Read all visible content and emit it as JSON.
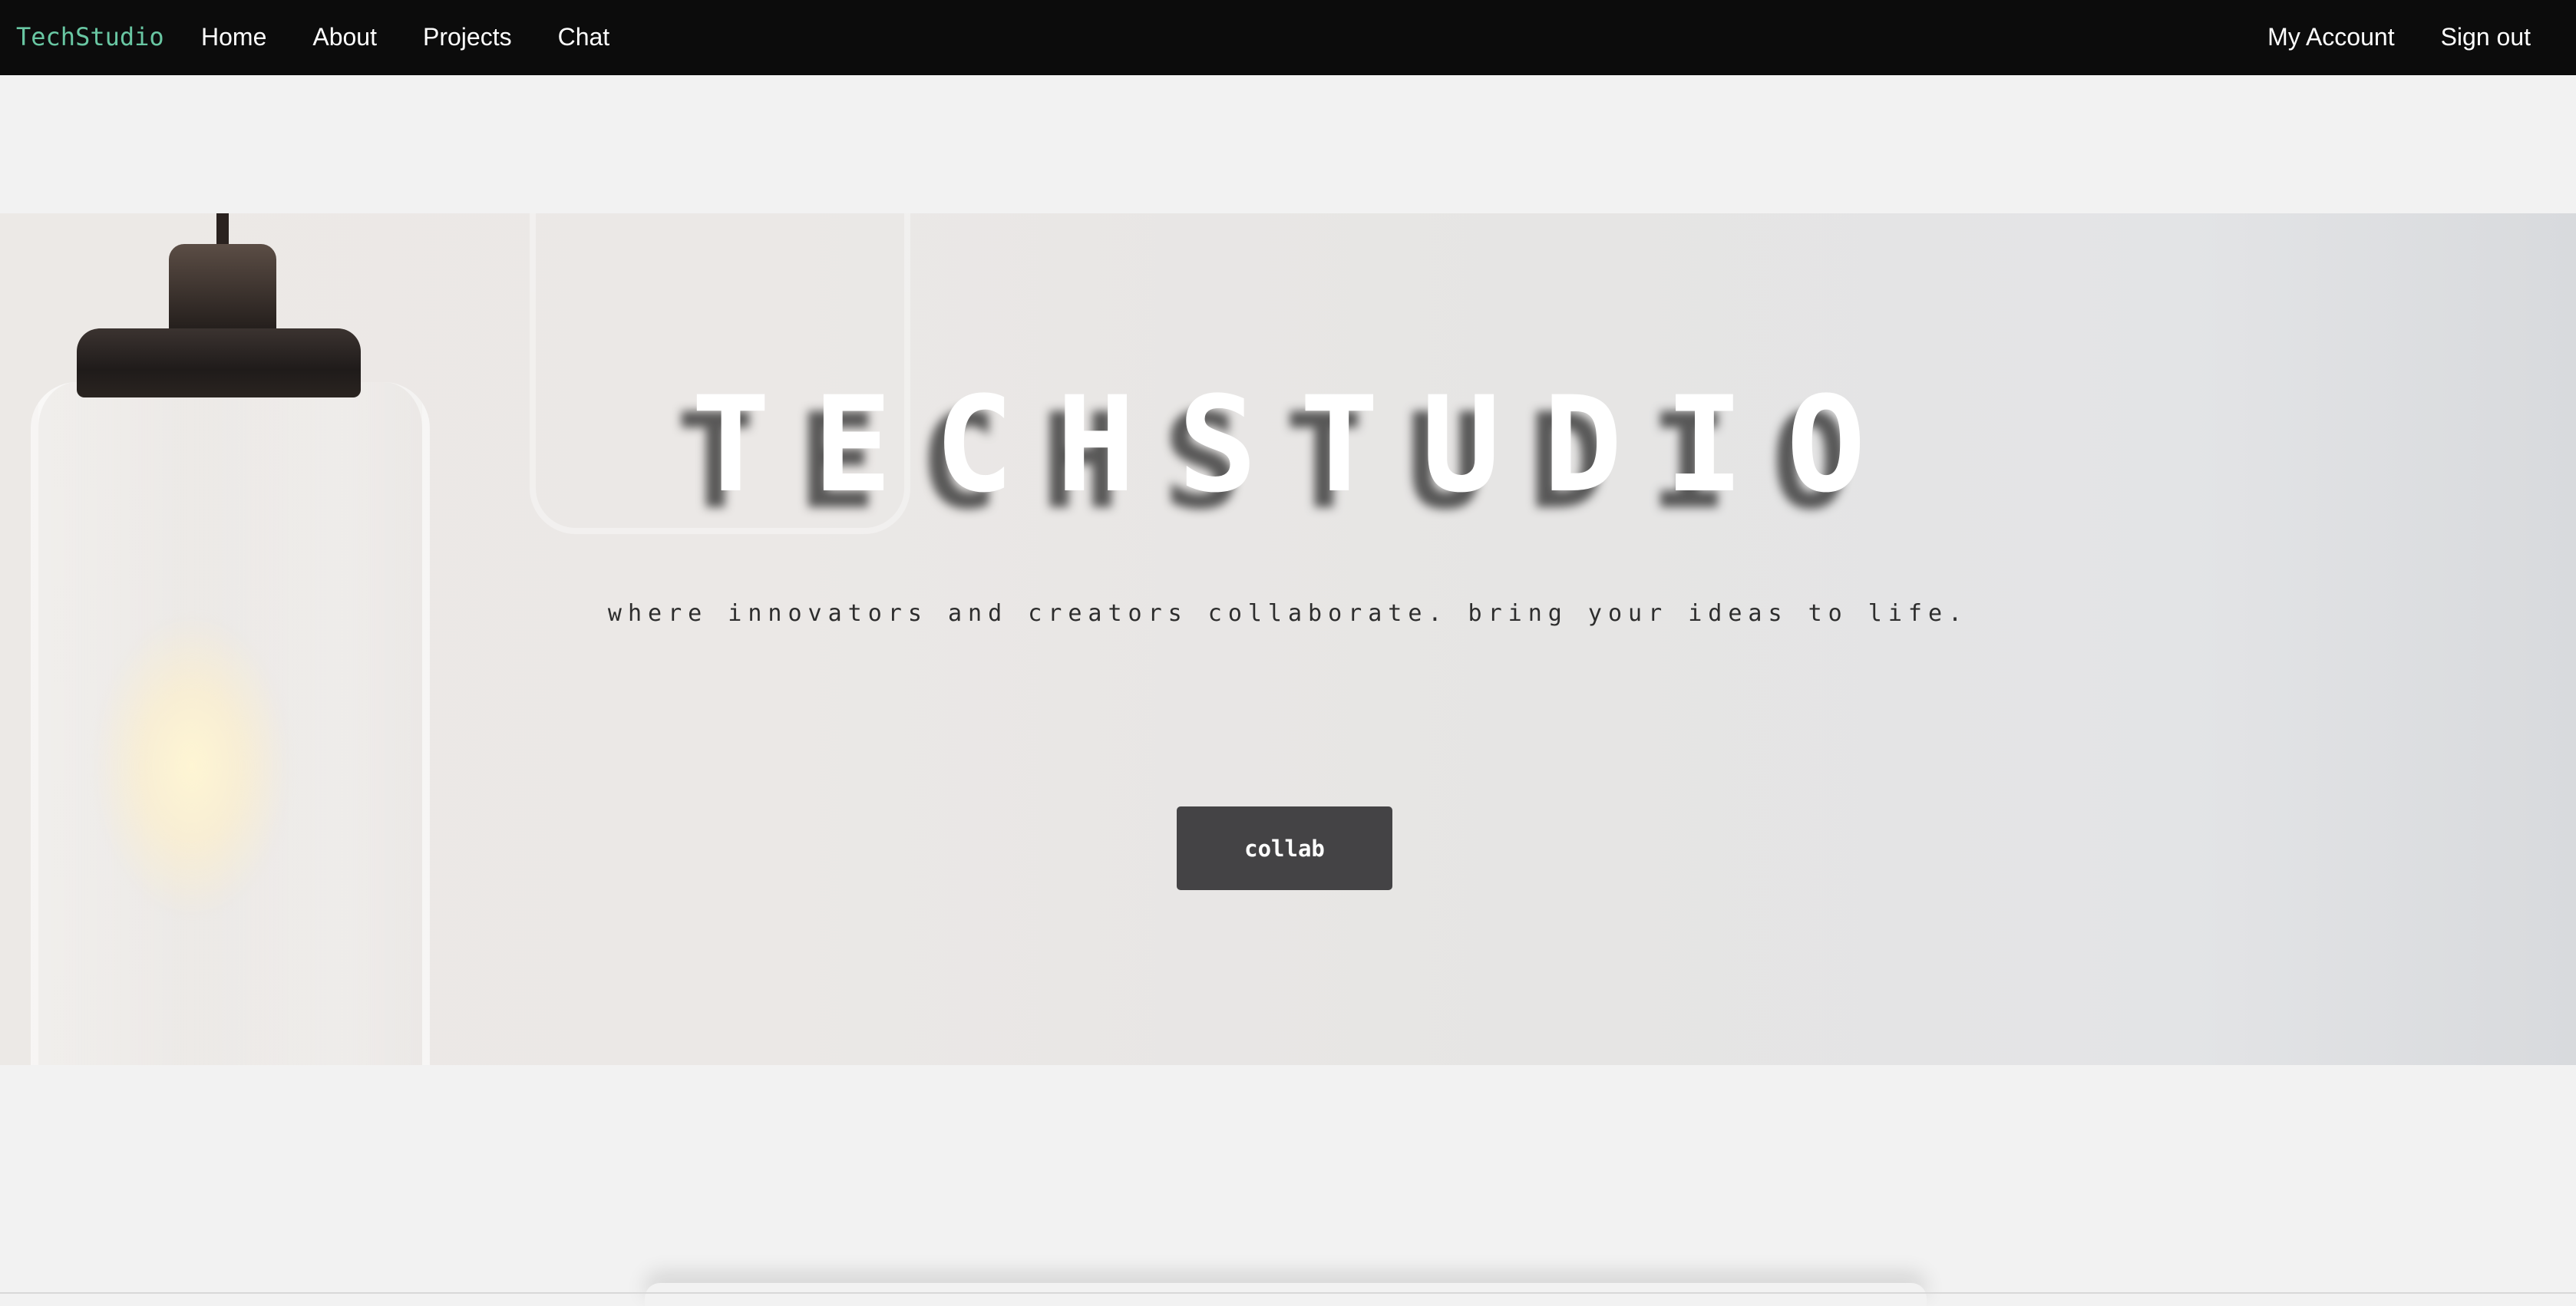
{
  "navbar": {
    "brand": "TechStudio",
    "left_links": [
      {
        "label": "Home"
      },
      {
        "label": "About"
      },
      {
        "label": "Projects"
      },
      {
        "label": "Chat"
      }
    ],
    "right_links": [
      {
        "label": "My Account"
      },
      {
        "label": "Sign out"
      }
    ]
  },
  "hero": {
    "title": "TECHSTUDIO",
    "subtitle": "where innovators and creators collaborate. bring your ideas to life.",
    "cta_label": "collab"
  },
  "colors": {
    "navbar_bg": "#0c0c0c",
    "brand": "#69c7a3",
    "page_bg": "#f2f2f2",
    "button_bg": "#444345"
  }
}
